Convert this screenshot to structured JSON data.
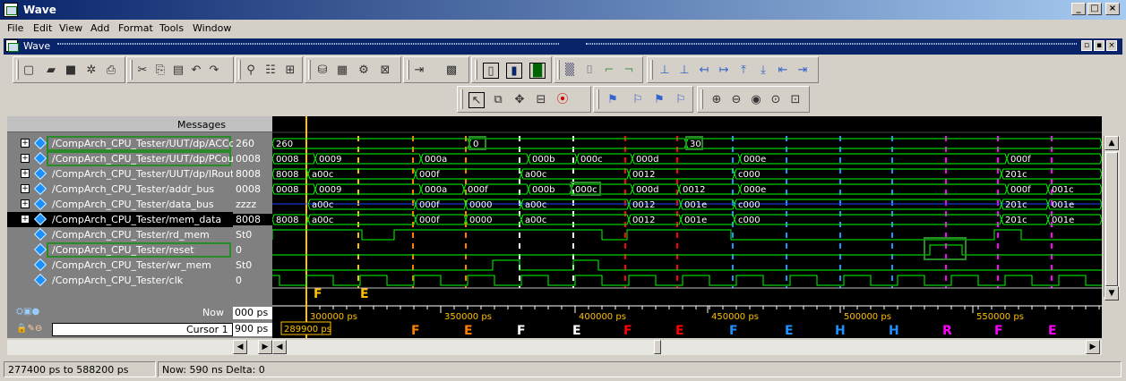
{
  "window": {
    "title": "Wave",
    "min": "_",
    "max": "□",
    "close": "×"
  },
  "menu": [
    "File",
    "Edit",
    "View",
    "Add",
    "Format",
    "Tools",
    "Window"
  ],
  "doc": {
    "title": "Wave"
  },
  "panel": {
    "messages_header": "Messages"
  },
  "signals": [
    {
      "name": "/CompArch_CPU_Tester/UUT/dp/ACCout",
      "value": "260",
      "expand": "+",
      "highlight": true
    },
    {
      "name": "/CompArch_CPU_Tester/UUT/dp/PCout",
      "value": "0008",
      "expand": "+",
      "highlight": true
    },
    {
      "name": "/CompArch_CPU_Tester/UUT/dp/IRout",
      "value": "8008",
      "expand": "+",
      "highlight": false
    },
    {
      "name": "/CompArch_CPU_Tester/addr_bus",
      "value": "0008",
      "expand": "+",
      "highlight": false
    },
    {
      "name": "/CompArch_CPU_Tester/data_bus",
      "value": "zzzz",
      "expand": "+",
      "highlight": false
    },
    {
      "name": "/CompArch_CPU_Tester/mem_data",
      "value": "8008",
      "expand": "+",
      "highlight": false,
      "selected": true
    },
    {
      "name": "/CompArch_CPU_Tester/rd_mem",
      "value": "St0",
      "expand": "",
      "highlight": false
    },
    {
      "name": "/CompArch_CPU_Tester/reset",
      "value": "0",
      "expand": "",
      "highlight": true
    },
    {
      "name": "/CompArch_CPU_Tester/wr_mem",
      "value": "St0",
      "expand": "",
      "highlight": false
    },
    {
      "name": "/CompArch_CPU_Tester/clk",
      "value": "0",
      "expand": "",
      "highlight": false
    }
  ],
  "bus_values": {
    "ACCout": [
      "260",
      "0",
      "30"
    ],
    "PCout": [
      "0008",
      "0009",
      "000a",
      "000b",
      "000c",
      "000d",
      "000e",
      "000f"
    ],
    "IRout": [
      "8008",
      "a00c",
      "000f",
      "a00c",
      "0012",
      "c000",
      "201c"
    ],
    "addr_bus": [
      "0008",
      "0009",
      "000a",
      "000f",
      "000b",
      "000c",
      "000d",
      "0012",
      "000e",
      "000f",
      "001c"
    ],
    "data_bus": [
      "a00c",
      "000f",
      "0000",
      "a00c",
      "0012",
      "001e",
      "c000",
      "201c",
      "001e"
    ],
    "mem_data": [
      "8008",
      "a00c",
      "000f",
      "0000",
      "a00c",
      "0012",
      "001e",
      "c000",
      "201c",
      "001e"
    ]
  },
  "wave_markers": [
    {
      "label": "F",
      "color": "#ffc000"
    },
    {
      "label": "E",
      "color": "#ffc000"
    }
  ],
  "now": {
    "label": "Now",
    "value": "000 ps"
  },
  "cursor": {
    "label": "Cursor 1",
    "value": "900 ps",
    "flag": "289900 ps",
    "color": "#ffc000"
  },
  "timeline": {
    "ticks": [
      "300000 ps",
      "350000 ps",
      "400000 ps",
      "450000 ps",
      "500000 ps",
      "550000 ps"
    ]
  },
  "phases": [
    {
      "label": "F",
      "color": "#ff7f00"
    },
    {
      "label": "E",
      "color": "#ff7f00"
    },
    {
      "label": "F",
      "color": "#ffffff"
    },
    {
      "label": "E",
      "color": "#ffffff"
    },
    {
      "label": "F",
      "color": "#ff0000"
    },
    {
      "label": "E",
      "color": "#ff0000"
    },
    {
      "label": "F",
      "color": "#1e90ff"
    },
    {
      "label": "E",
      "color": "#1e90ff"
    },
    {
      "label": "H",
      "color": "#1e90ff"
    },
    {
      "label": "H",
      "color": "#1e90ff"
    },
    {
      "label": "R",
      "color": "#ff00ff"
    },
    {
      "label": "F",
      "color": "#ff00ff"
    },
    {
      "label": "E",
      "color": "#ff00ff"
    }
  ],
  "status": {
    "range": "277400 ps to 588200 ps",
    "now": "Now: 590 ns  Delta: 0"
  },
  "colors": {
    "wave": "#00ff00",
    "cursor": "#ffc000",
    "bus_text": "#ffffff",
    "highlight": "#2a8a2a"
  }
}
